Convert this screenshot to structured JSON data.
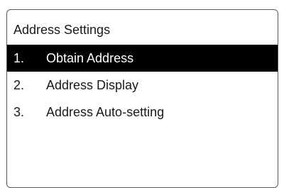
{
  "screen": {
    "title": "Address Settings"
  },
  "menu": {
    "selected_index": 0,
    "items": [
      {
        "number": "1.",
        "label": "Obtain Address"
      },
      {
        "number": "2.",
        "label": "Address Display"
      },
      {
        "number": "3.",
        "label": "Address Auto-setting"
      }
    ]
  },
  "colors": {
    "highlight_background": "#000000",
    "highlight_text": "#ffffff",
    "border": "#5a5a5a"
  }
}
